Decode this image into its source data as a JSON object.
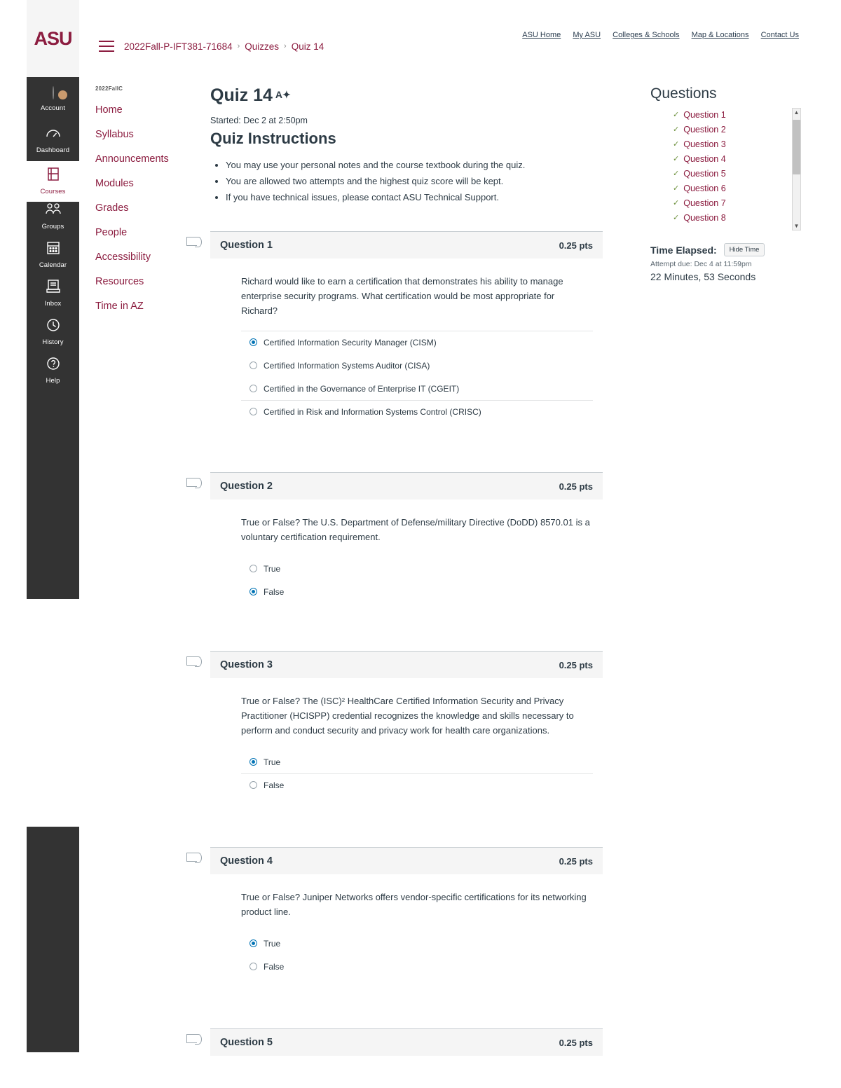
{
  "brand": {
    "logo_text": "ASU",
    "maroon": "#8c1d40",
    "gold": "#ffc627",
    "link_blue": "#0374b5"
  },
  "utility_links": [
    {
      "label": "ASU Home"
    },
    {
      "label": "My ASU"
    },
    {
      "label": "Colleges & Schools"
    },
    {
      "label": "Map & Locations"
    },
    {
      "label": "Contact Us"
    }
  ],
  "breadcrumb": {
    "items": [
      {
        "label": "2022Fall-P-IFT381-71684"
      },
      {
        "label": "Quizzes"
      },
      {
        "label": "Quiz 14"
      }
    ],
    "separator": "›"
  },
  "global_nav": {
    "items": [
      {
        "label": "Account",
        "icon": "avatar-icon",
        "glyph": "",
        "active": false
      },
      {
        "label": "Dashboard",
        "icon": "dashboard-gauge-icon",
        "glyph": "◔",
        "active": false
      },
      {
        "label": "Courses",
        "icon": "courses-book-icon",
        "glyph": "☷",
        "active": true
      },
      {
        "label": "Groups",
        "icon": "groups-people-icon",
        "glyph": "⛟",
        "active": false
      },
      {
        "label": "Calendar",
        "icon": "calendar-icon",
        "glyph": "▦",
        "active": false
      },
      {
        "label": "Inbox",
        "icon": "inbox-tray-icon",
        "glyph": "☰",
        "active": false
      },
      {
        "label": "History",
        "icon": "history-clock-icon",
        "glyph": "◷",
        "active": false
      },
      {
        "label": "Help",
        "icon": "help-question-icon",
        "glyph": "?",
        "active": false
      }
    ]
  },
  "course_nav": {
    "term_label": "2022FallC",
    "items": [
      {
        "label": "Home"
      },
      {
        "label": "Syllabus"
      },
      {
        "label": "Announcements"
      },
      {
        "label": "Modules"
      },
      {
        "label": "Grades"
      },
      {
        "label": "People"
      },
      {
        "label": "Accessibility"
      },
      {
        "label": "Resources"
      },
      {
        "label": "Time in AZ"
      }
    ]
  },
  "quiz": {
    "title": "Quiz 14",
    "accessibility_mark": "A✦",
    "started_text": "Started: Dec 2 at 2:50pm",
    "instructions_heading": "Quiz Instructions",
    "instructions": [
      "You may use your personal notes and the course textbook during the quiz.",
      "You are allowed two attempts and the highest quiz score will be kept.",
      "If you have technical issues, please contact ASU Technical Support."
    ],
    "questions": [
      {
        "name": "Question 1",
        "points": "0.25 pts",
        "text": "Richard would like to earn a certification that demonstrates his ability to manage enterprise security programs. What certification would be most appropriate for Richard?",
        "answers": [
          {
            "label": "Certified Information Security Manager (CISM)",
            "selected": true,
            "divider": false
          },
          {
            "label": "Certified Information Systems Auditor (CISA)",
            "selected": false,
            "divider": false
          },
          {
            "label": "Certified in the Governance of Enterprise IT (CGEIT)",
            "selected": false,
            "divider": false
          },
          {
            "label": "Certified in Risk and Information Systems Control (CRISC)",
            "selected": false,
            "divider": true
          }
        ]
      },
      {
        "name": "Question 2",
        "points": "0.25 pts",
        "text": "True or False? The U.S. Department of Defense/military Directive (DoDD) 8570.01 is a voluntary certification requirement.",
        "answers": [
          {
            "label": "True",
            "selected": false,
            "divider": false
          },
          {
            "label": "False",
            "selected": true,
            "divider": false
          }
        ]
      },
      {
        "name": "Question 3",
        "points": "0.25 pts",
        "text": "True or False? The (ISC)² HealthCare Certified Information Security and Privacy Practitioner (HCISPP) credential recognizes the knowledge and skills necessary to perform and conduct security and privacy work for health care organizations.",
        "answers": [
          {
            "label": "True",
            "selected": true,
            "divider": false
          },
          {
            "label": "False",
            "selected": false,
            "divider": true
          }
        ]
      },
      {
        "name": "Question 4",
        "points": "0.25 pts",
        "text": "True or False? Juniper Networks offers vendor-specific certifications for its networking product line.",
        "answers": [
          {
            "label": "True",
            "selected": true,
            "divider": false
          },
          {
            "label": "False",
            "selected": false,
            "divider": false
          }
        ]
      },
      {
        "name": "Question 5",
        "points": "0.25 pts",
        "text": "",
        "answers": []
      }
    ]
  },
  "right_sidebar": {
    "heading": "Questions",
    "question_links": [
      {
        "label": "Question 1",
        "answered": true
      },
      {
        "label": "Question 2",
        "answered": true
      },
      {
        "label": "Question 3",
        "answered": true
      },
      {
        "label": "Question 4",
        "answered": true
      },
      {
        "label": "Question 5",
        "answered": true
      },
      {
        "label": "Question 6",
        "answered": true
      },
      {
        "label": "Question 7",
        "answered": true
      },
      {
        "label": "Question 8",
        "answered": true
      }
    ],
    "check_glyph": "✓",
    "scroll_up_glyph": "▲",
    "scroll_down_glyph": "▼",
    "time_elapsed_label": "Time Elapsed:",
    "hide_time_label": "Hide Time",
    "attempt_due": "Attempt due: Dec 4 at 11:59pm",
    "time_value": "22 Minutes, 53 Seconds"
  }
}
